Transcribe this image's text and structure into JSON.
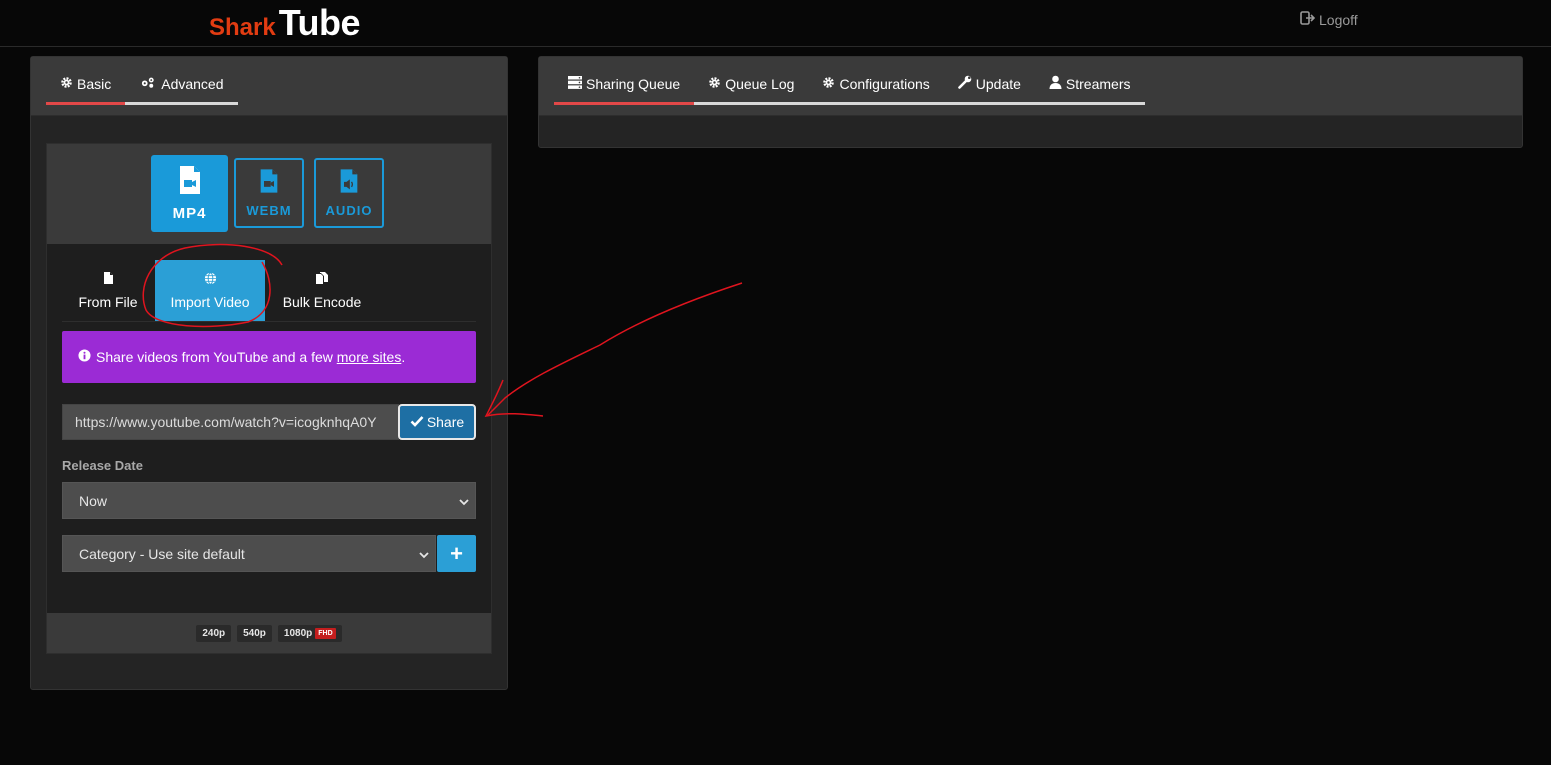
{
  "header": {
    "logo_part1": "Shark",
    "logo_part2": "Tube",
    "logoff_label": "Logoff"
  },
  "left_panel": {
    "tabs": [
      {
        "label": "Basic",
        "icon": "gear-icon",
        "active": true
      },
      {
        "label": "Advanced",
        "icon": "gears-icon",
        "active": false
      }
    ],
    "formats": [
      {
        "label": "MP4",
        "icon": "video-file-icon",
        "active": true
      },
      {
        "label": "WEBM",
        "icon": "video-file-icon",
        "active": false
      },
      {
        "label": "AUDIO",
        "icon": "audio-file-icon",
        "active": false
      }
    ],
    "source_tabs": [
      {
        "label": "From File",
        "icon": "file-icon",
        "active": false
      },
      {
        "label": "Import Video",
        "icon": "globe-icon",
        "active": true
      },
      {
        "label": "Bulk Encode",
        "icon": "files-icon",
        "active": false
      }
    ],
    "info_text": "Share videos from YouTube and a few ",
    "info_link": "more sites",
    "info_suffix": ".",
    "url_value": "https://www.youtube.com/watch?v=icogknhqA0Y",
    "share_label": "Share",
    "release_date_label": "Release Date",
    "release_date_value": "Now",
    "category_value": "Category - Use site default",
    "plus_label": "+",
    "resolutions": [
      {
        "label": "240p"
      },
      {
        "label": "540p"
      },
      {
        "label": "1080p",
        "badge": "FHD"
      }
    ]
  },
  "right_panel": {
    "tabs": [
      {
        "label": "Sharing Queue",
        "icon": "server-icon",
        "active": true
      },
      {
        "label": "Queue Log",
        "icon": "gear-icon",
        "active": false
      },
      {
        "label": "Configurations",
        "icon": "gear-icon",
        "active": false
      },
      {
        "label": "Update",
        "icon": "wrench-icon",
        "active": false
      },
      {
        "label": "Streamers",
        "icon": "user-icon",
        "active": false
      }
    ]
  },
  "colors": {
    "accent_blue": "#2b9fd6",
    "tab_underline_red": "#e24848",
    "info_purple": "#9b2bd5",
    "logo_red": "#e23c12",
    "annotation_red": "#e0141e"
  }
}
